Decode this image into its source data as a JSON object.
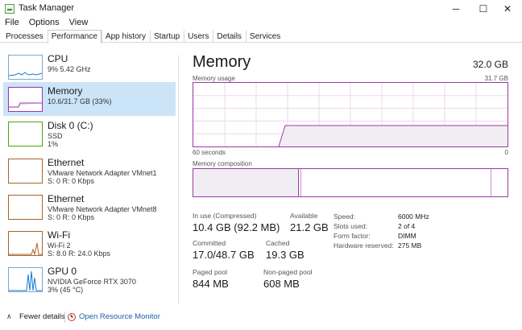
{
  "window": {
    "title": "Task Manager",
    "min_glyph": "─",
    "max_glyph": "☐",
    "close_glyph": "✕"
  },
  "menu": [
    "File",
    "Options",
    "View"
  ],
  "tabs": [
    "Processes",
    "Performance",
    "App history",
    "Startup",
    "Users",
    "Details",
    "Services"
  ],
  "active_tab": "Performance",
  "sidebar": [
    {
      "name": "CPU",
      "line1": "9%  5.42 GHz",
      "line2": "",
      "color": "#1779d4",
      "selected": false
    },
    {
      "name": "Memory",
      "line1": "10.6/31.7 GB (33%)",
      "line2": "",
      "color": "#9b38a6",
      "selected": true
    },
    {
      "name": "Disk 0 (C:)",
      "line1": "SSD",
      "line2": "1%",
      "color": "#4da60c",
      "selected": false
    },
    {
      "name": "Ethernet",
      "line1": "VMware Network Adapter VMnet1",
      "line2": "S: 0 R: 0 Kbps",
      "color": "#a7642a",
      "selected": false
    },
    {
      "name": "Ethernet",
      "line1": "VMware Network Adapter VMnet8",
      "line2": "S: 0 R: 0 Kbps",
      "color": "#a7642a",
      "selected": false
    },
    {
      "name": "Wi-Fi",
      "line1": "Wi-Fi 2",
      "line2": "S: 8.0  R: 24.0 Kbps",
      "color": "#a7642a",
      "selected": false
    },
    {
      "name": "GPU 0",
      "line1": "NVIDIA GeForce RTX 3070",
      "line2": "3%  (45 °C)",
      "color": "#1779d4",
      "selected": false
    }
  ],
  "memory": {
    "title": "Memory",
    "total": "32.0 GB",
    "usage_label": "Memory usage",
    "usage_max": "31.7 GB",
    "time_left": "60 seconds",
    "time_right": "0",
    "composition_label": "Memory composition",
    "in_use_fraction": 0.335,
    "standby_edge_fraction": 0.34,
    "free_edge_fraction": 0.945,
    "stats": [
      {
        "label": "In use (Compressed)",
        "value": "10.4 GB (92.2 MB)"
      },
      {
        "label": "Available",
        "value": "21.2 GB"
      },
      {
        "label": "Committed",
        "value": "17.0/48.7 GB"
      },
      {
        "label": "Cached",
        "value": "19.3 GB"
      },
      {
        "label": "Paged pool",
        "value": "844 MB"
      },
      {
        "label": "Non-paged pool",
        "value": "608 MB"
      }
    ],
    "details": [
      {
        "key": "Speed:",
        "value": "6000 MHz"
      },
      {
        "key": "Slots used:",
        "value": "2 of 4"
      },
      {
        "key": "Form factor:",
        "value": "DIMM"
      },
      {
        "key": "Hardware reserved:",
        "value": "275 MB"
      }
    ]
  },
  "footer": {
    "fewer_details": "Fewer details",
    "open_resource_monitor": "Open Resource Monitor"
  },
  "colors": {
    "memory_accent": "#9b38a6",
    "selection": "#cce4f7",
    "link": "#1a5fb4"
  }
}
